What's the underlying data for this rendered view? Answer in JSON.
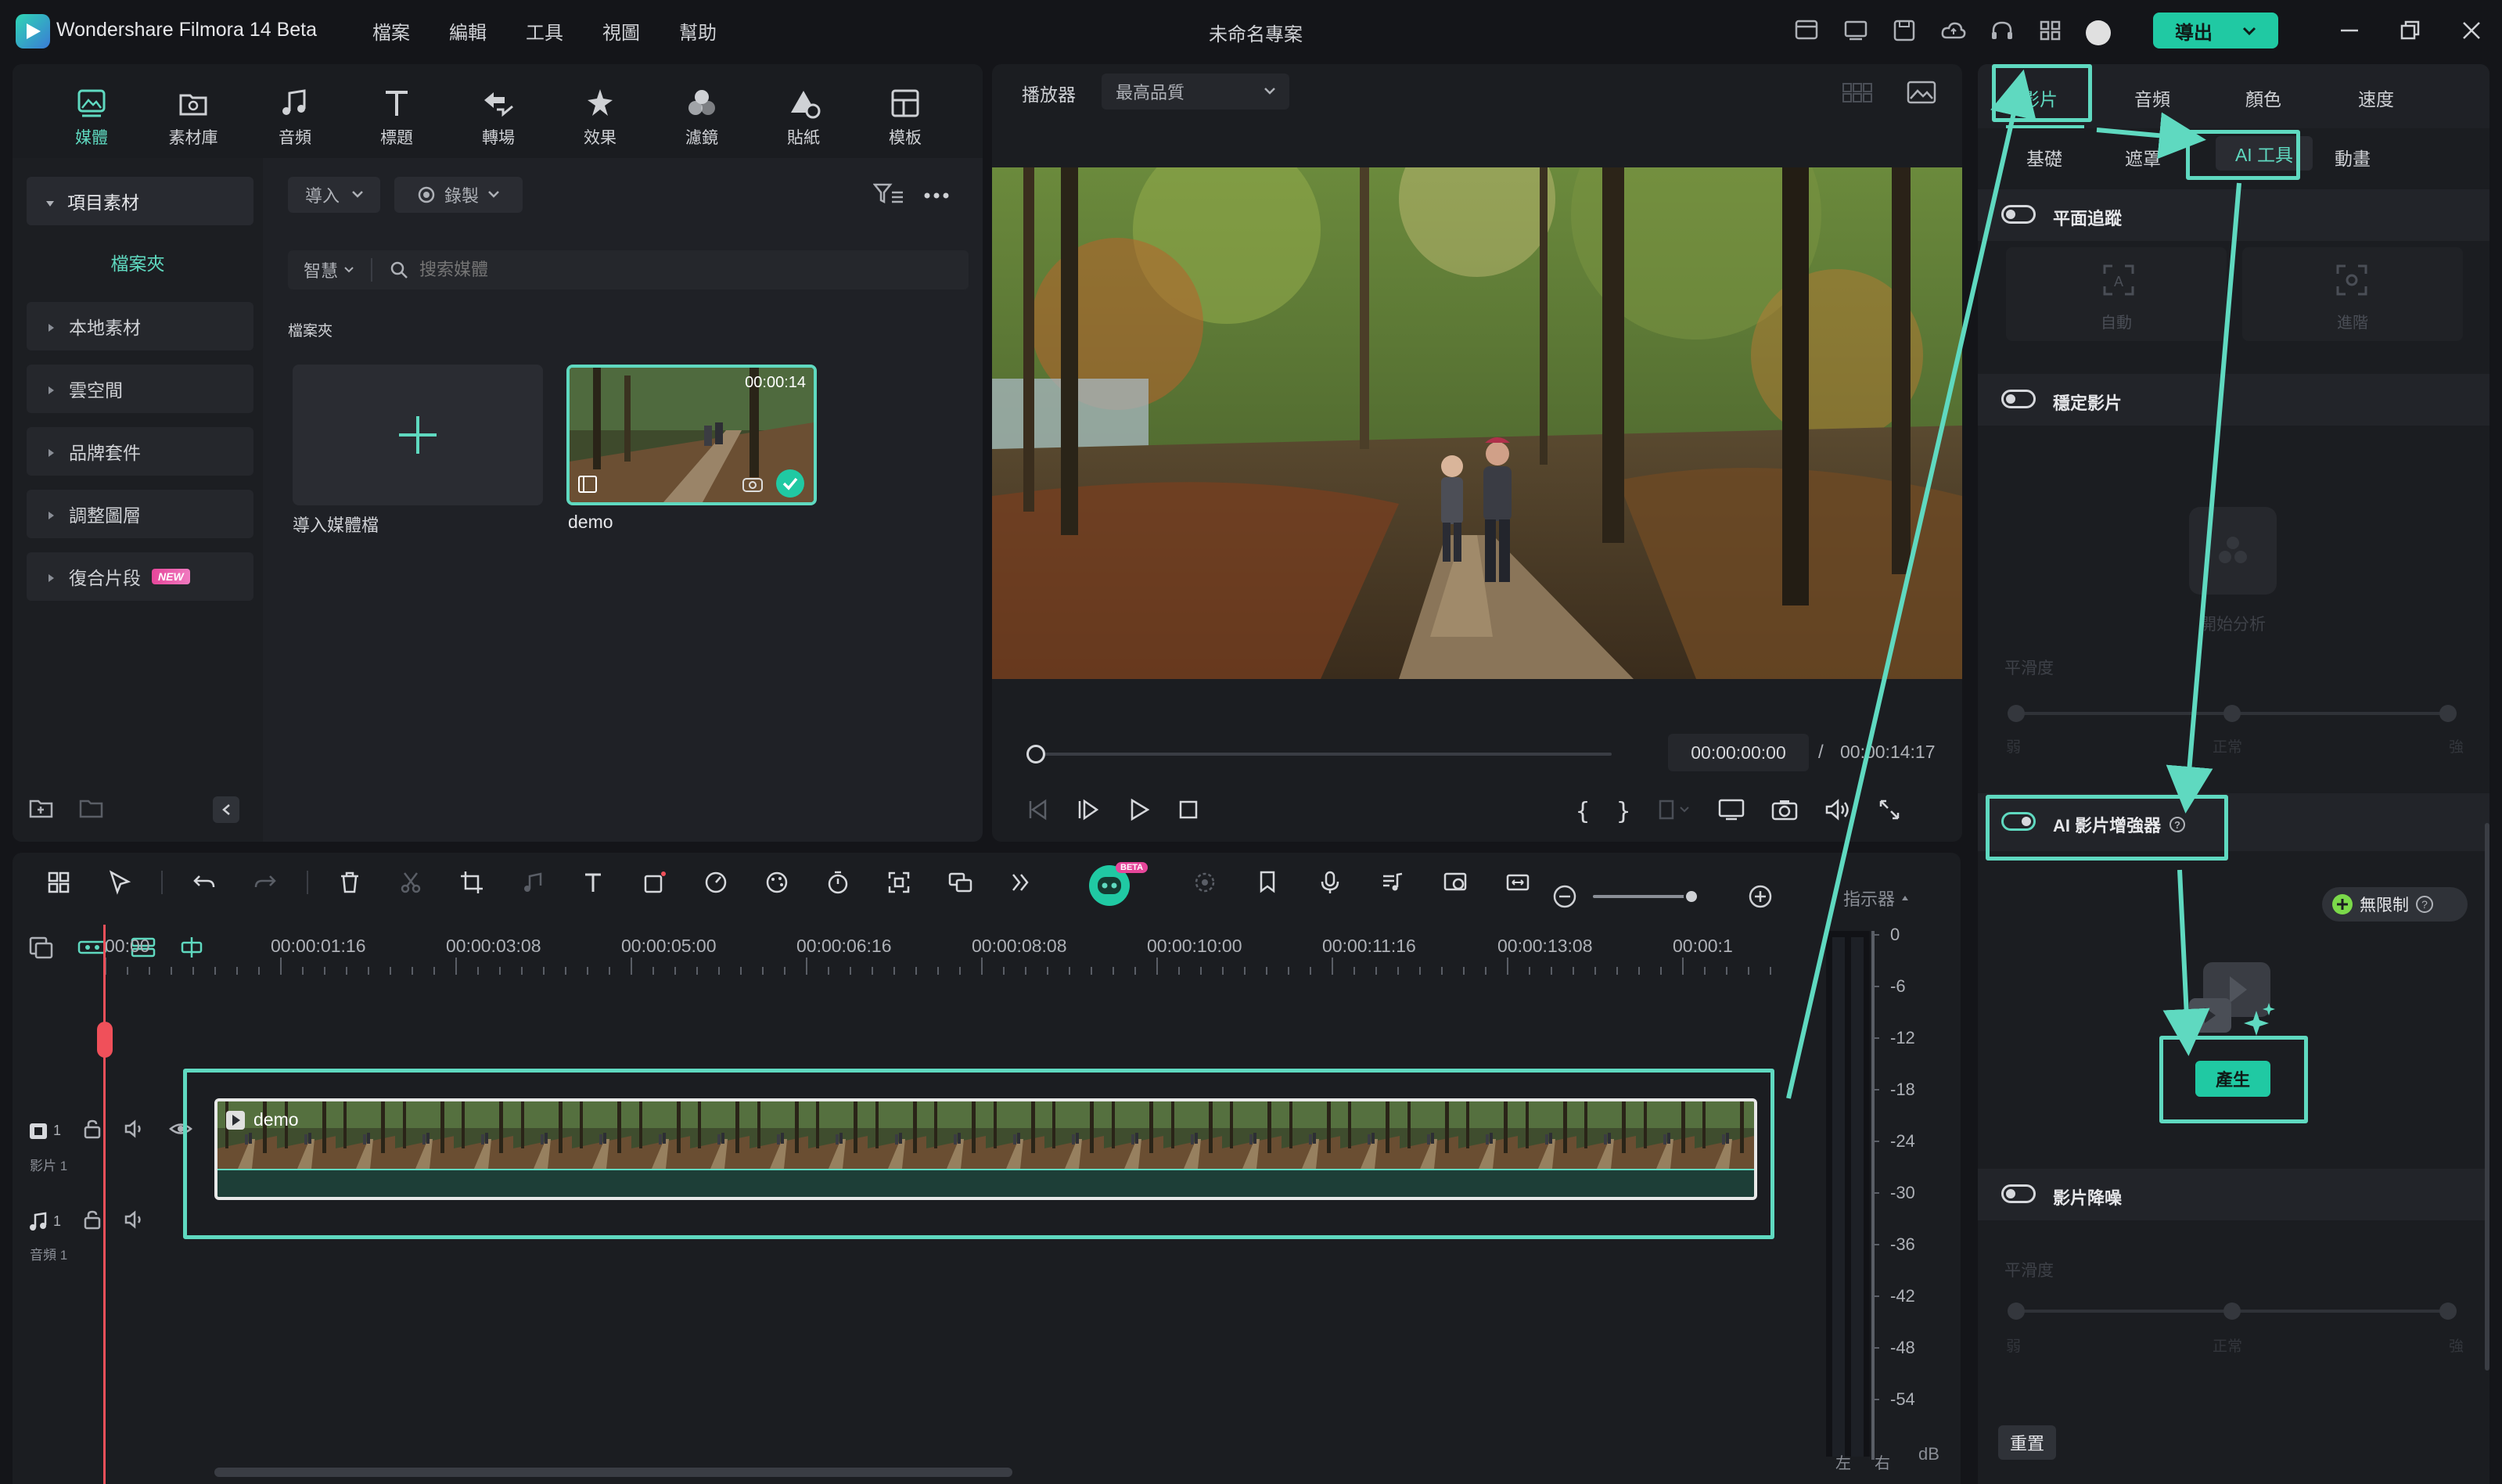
{
  "titlebar": {
    "app_name": "Wondershare Filmora 14 Beta",
    "menus": [
      "檔案",
      "編輯",
      "工具",
      "視圖",
      "幫助"
    ],
    "project_title": "未命名專案",
    "export_label": "導出"
  },
  "top_tabs": [
    {
      "label": "媒體",
      "icon": "media-icon",
      "active": true
    },
    {
      "label": "素材庫",
      "icon": "library-icon"
    },
    {
      "label": "音頻",
      "icon": "music-note-icon"
    },
    {
      "label": "標題",
      "icon": "title-t-icon"
    },
    {
      "label": "轉場",
      "icon": "transition-icon"
    },
    {
      "label": "效果",
      "icon": "effects-star-icon"
    },
    {
      "label": "濾鏡",
      "icon": "filter-icon"
    },
    {
      "label": "貼紙",
      "icon": "sticker-icon"
    },
    {
      "label": "模板",
      "icon": "template-icon"
    }
  ],
  "media_sidebar": {
    "project_media": "項目素材",
    "folder": "檔案夾",
    "items": [
      "本地素材",
      "雲空間",
      "品牌套件",
      "調整圖層",
      "復合片段"
    ],
    "new_badge": "NEW"
  },
  "media_toolbar": {
    "import_label": "導入",
    "record_label": "錄製",
    "smart_label": "智慧",
    "search_placeholder": "搜索媒體",
    "folder_heading": "檔案夾"
  },
  "media_items": {
    "import_caption": "導入媒體檔",
    "clip_name": "demo",
    "clip_duration": "00:00:14"
  },
  "player": {
    "label": "播放器",
    "quality": "最高品質",
    "current_time": "00:00:00:00",
    "separator": "/",
    "total_time": "00:00:14:17"
  },
  "timeline": {
    "ruler": [
      "00:00",
      "00:00:01:16",
      "00:00:03:08",
      "00:00:05:00",
      "00:00:06:16",
      "00:00:08:08",
      "00:00:10:00",
      "00:00:11:16",
      "00:00:13:08",
      "00:00:1"
    ],
    "video_track_num": "1",
    "video_track_label": "影片 1",
    "audio_track_num": "1",
    "audio_track_label": "音頻 1",
    "clip_label": "demo",
    "beta_badge": "BETA",
    "meter_label": "指示器"
  },
  "meter": {
    "scale": [
      "0",
      "-6",
      "-12",
      "-18",
      "-24",
      "-30",
      "-36",
      "-42",
      "-48",
      "-54"
    ],
    "unit": "dB",
    "left": "左",
    "right": "右"
  },
  "right_panel": {
    "main_tabs": [
      "影片",
      "音頻",
      "顏色",
      "速度"
    ],
    "sub_tabs": [
      "基礎",
      "遮罩",
      "AI 工具",
      "動畫"
    ],
    "plane_tracking": "平面追蹤",
    "auto_label": "自動",
    "advanced_label": "進階",
    "stabilize": "穩定影片",
    "analyze_label": "開始分析",
    "smoothness": "平滑度",
    "low": "弱",
    "normal": "正常",
    "high": "強",
    "ai_enhancer": "AI 影片增強器",
    "unlimited": "無限制",
    "generate": "產生",
    "denoise": "影片降噪",
    "smoothness2": "平滑度",
    "low2": "弱",
    "normal2": "正常",
    "high2": "強",
    "reset": "重置"
  },
  "colors": {
    "accent": "#5fd9c0",
    "export_bg": "#20c9a3",
    "playhead": "#f0505a",
    "bg": "#141519",
    "panel": "#1f2126"
  }
}
